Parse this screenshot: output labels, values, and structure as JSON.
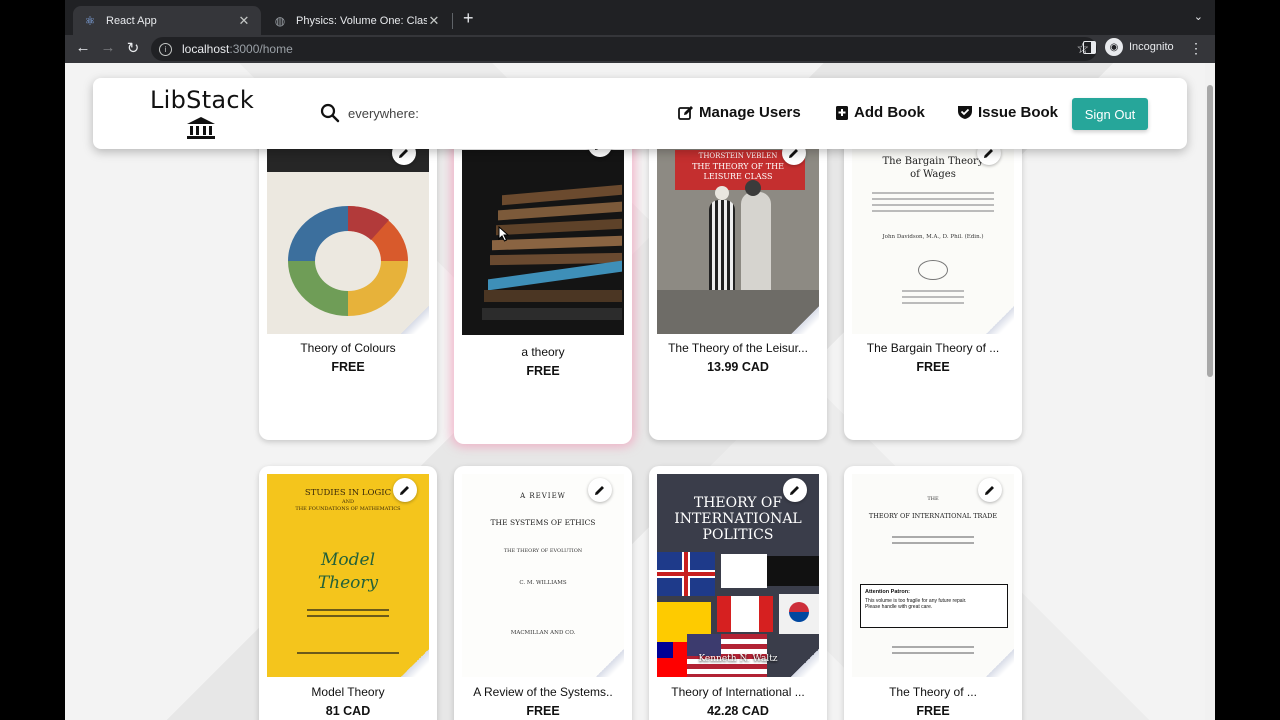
{
  "browser": {
    "tabs": [
      {
        "title": "React App",
        "active": true
      },
      {
        "title": "Physics: Volume One: Classica",
        "active": false
      }
    ],
    "url_host": "localhost",
    "url_rest": ":3000/home",
    "profile_label": "Incognito"
  },
  "header": {
    "logo": "LibStack",
    "search_placeholder": "everywhere:",
    "nav": {
      "manage_users": "Manage Users",
      "add_book": "Add Book",
      "issue_book": "Issue Book"
    },
    "sign_out": "Sign Out",
    "accent_color": "#26a69a"
  },
  "books": [
    {
      "title": "Theory of Colours",
      "price": "FREE"
    },
    {
      "title": "a theory",
      "price": "FREE"
    },
    {
      "title": "The Theory of the Leisur...",
      "price": "13.99 CAD",
      "cover_text": [
        "THORSTEIN VEBLEN",
        "THE THEORY OF THE",
        "LEISURE CLASS"
      ]
    },
    {
      "title": "The Bargain Theory of ...",
      "price": "FREE",
      "cover_text": [
        "The Bargain Theory",
        "of Wages",
        "John Davidson, M.A., D. Phil. (Edin.)"
      ]
    },
    {
      "title": "Model Theory",
      "price": "81 CAD",
      "cover_text": [
        "STUDIES IN LOGIC",
        "AND",
        "THE FOUNDATIONS OF MATHEMATICS",
        "Model",
        "Theory"
      ]
    },
    {
      "title": "A Review of the Systems..",
      "price": "FREE",
      "cover_text": [
        "A REVIEW",
        "THE SYSTEMS OF ETHICS",
        "THE THEORY OF EVOLUTION",
        "C. M. WILLIAMS",
        "MACMILLAN AND CO."
      ]
    },
    {
      "title": "Theory of International ...",
      "price": "42.28 CAD",
      "cover_text": [
        "THEORY OF",
        "INTERNATIONAL",
        "POLITICS",
        "Kenneth N. Waltz"
      ]
    },
    {
      "title": "The Theory of ...",
      "price": "FREE",
      "cover_text": [
        "THE",
        "THEORY OF INTERNATIONAL TRADE",
        "Attention Patron:",
        "This volume is too fragile for any future repair.",
        "Please handle with great care."
      ]
    }
  ]
}
